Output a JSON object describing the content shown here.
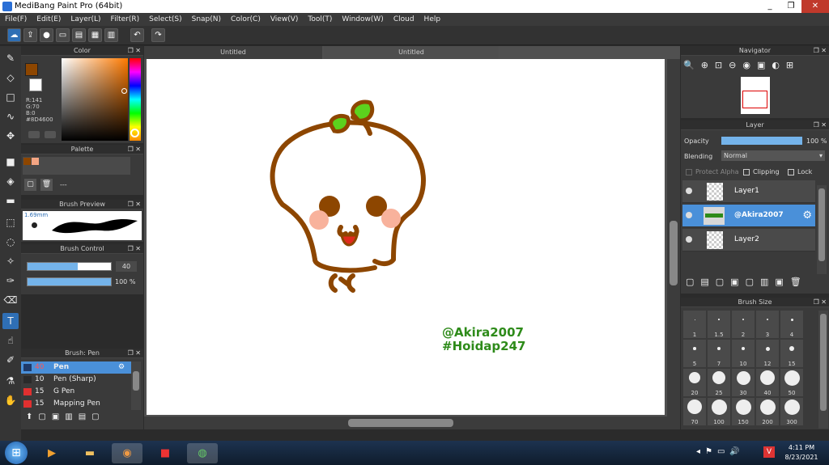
{
  "window": {
    "title": "MediBang Paint Pro (64bit)",
    "minimize": "_",
    "restore": "❐",
    "close": "✕"
  },
  "menu": [
    "File(F)",
    "Edit(E)",
    "Layer(L)",
    "Filter(R)",
    "Select(S)",
    "Snap(N)",
    "Color(C)",
    "View(V)",
    "Tool(T)",
    "Window(W)",
    "Cloud",
    "Help"
  ],
  "color_panel": {
    "title": "Color",
    "r": "R:141",
    "g": "G:70",
    "b": "B:0",
    "hex": "#8D4600",
    "primary": "#8D4600",
    "secondary": "#ffffff"
  },
  "palette_panel": {
    "title": "Palette",
    "dash": "---",
    "swatches": [
      "#8D4600",
      "#f4a583"
    ]
  },
  "brush_preview": {
    "title": "Brush Preview",
    "size": "1.69mm"
  },
  "brush_control": {
    "title": "Brush Control",
    "size_value": "40",
    "opacity_value": "100 %",
    "size_fraction": 0.6,
    "opacity_fraction": 1.0
  },
  "brush_list": {
    "title": "Brush: Pen",
    "items": [
      {
        "size": "40",
        "name": "Pen",
        "color": "#1f3b6a"
      },
      {
        "size": "10",
        "name": "Pen (Sharp)",
        "color": "#2a2a2a"
      },
      {
        "size": "15",
        "name": "G Pen",
        "color": "#e03030"
      },
      {
        "size": "15",
        "name": "Mapping Pen",
        "color": "#e03030"
      }
    ]
  },
  "tabs": [
    "Untitled",
    "Untitled"
  ],
  "canvas": {
    "watermark1": "@Akira2007",
    "watermark2": "#Hoidap247"
  },
  "navigator": {
    "title": "Navigator"
  },
  "layer_panel": {
    "title": "Layer",
    "opacity_label": "Opacity",
    "opacity_value": "100 %",
    "blending_label": "Blending",
    "blending_value": "Normal",
    "protect_alpha": "Protect Alpha",
    "clipping": "Clipping",
    "lock": "Lock",
    "layers": [
      {
        "name": "Layer1"
      },
      {
        "name": "@Akira2007"
      },
      {
        "name": "Layer2"
      }
    ]
  },
  "brush_size": {
    "title": "Brush Size",
    "sizes": [
      "1",
      "1.5",
      "2",
      "3",
      "4",
      "5",
      "7",
      "10",
      "12",
      "15",
      "20",
      "25",
      "30",
      "40",
      "50",
      "70",
      "100",
      "150",
      "200",
      "300"
    ]
  },
  "clock": {
    "time": "4:11 PM",
    "date": "8/23/2021"
  }
}
